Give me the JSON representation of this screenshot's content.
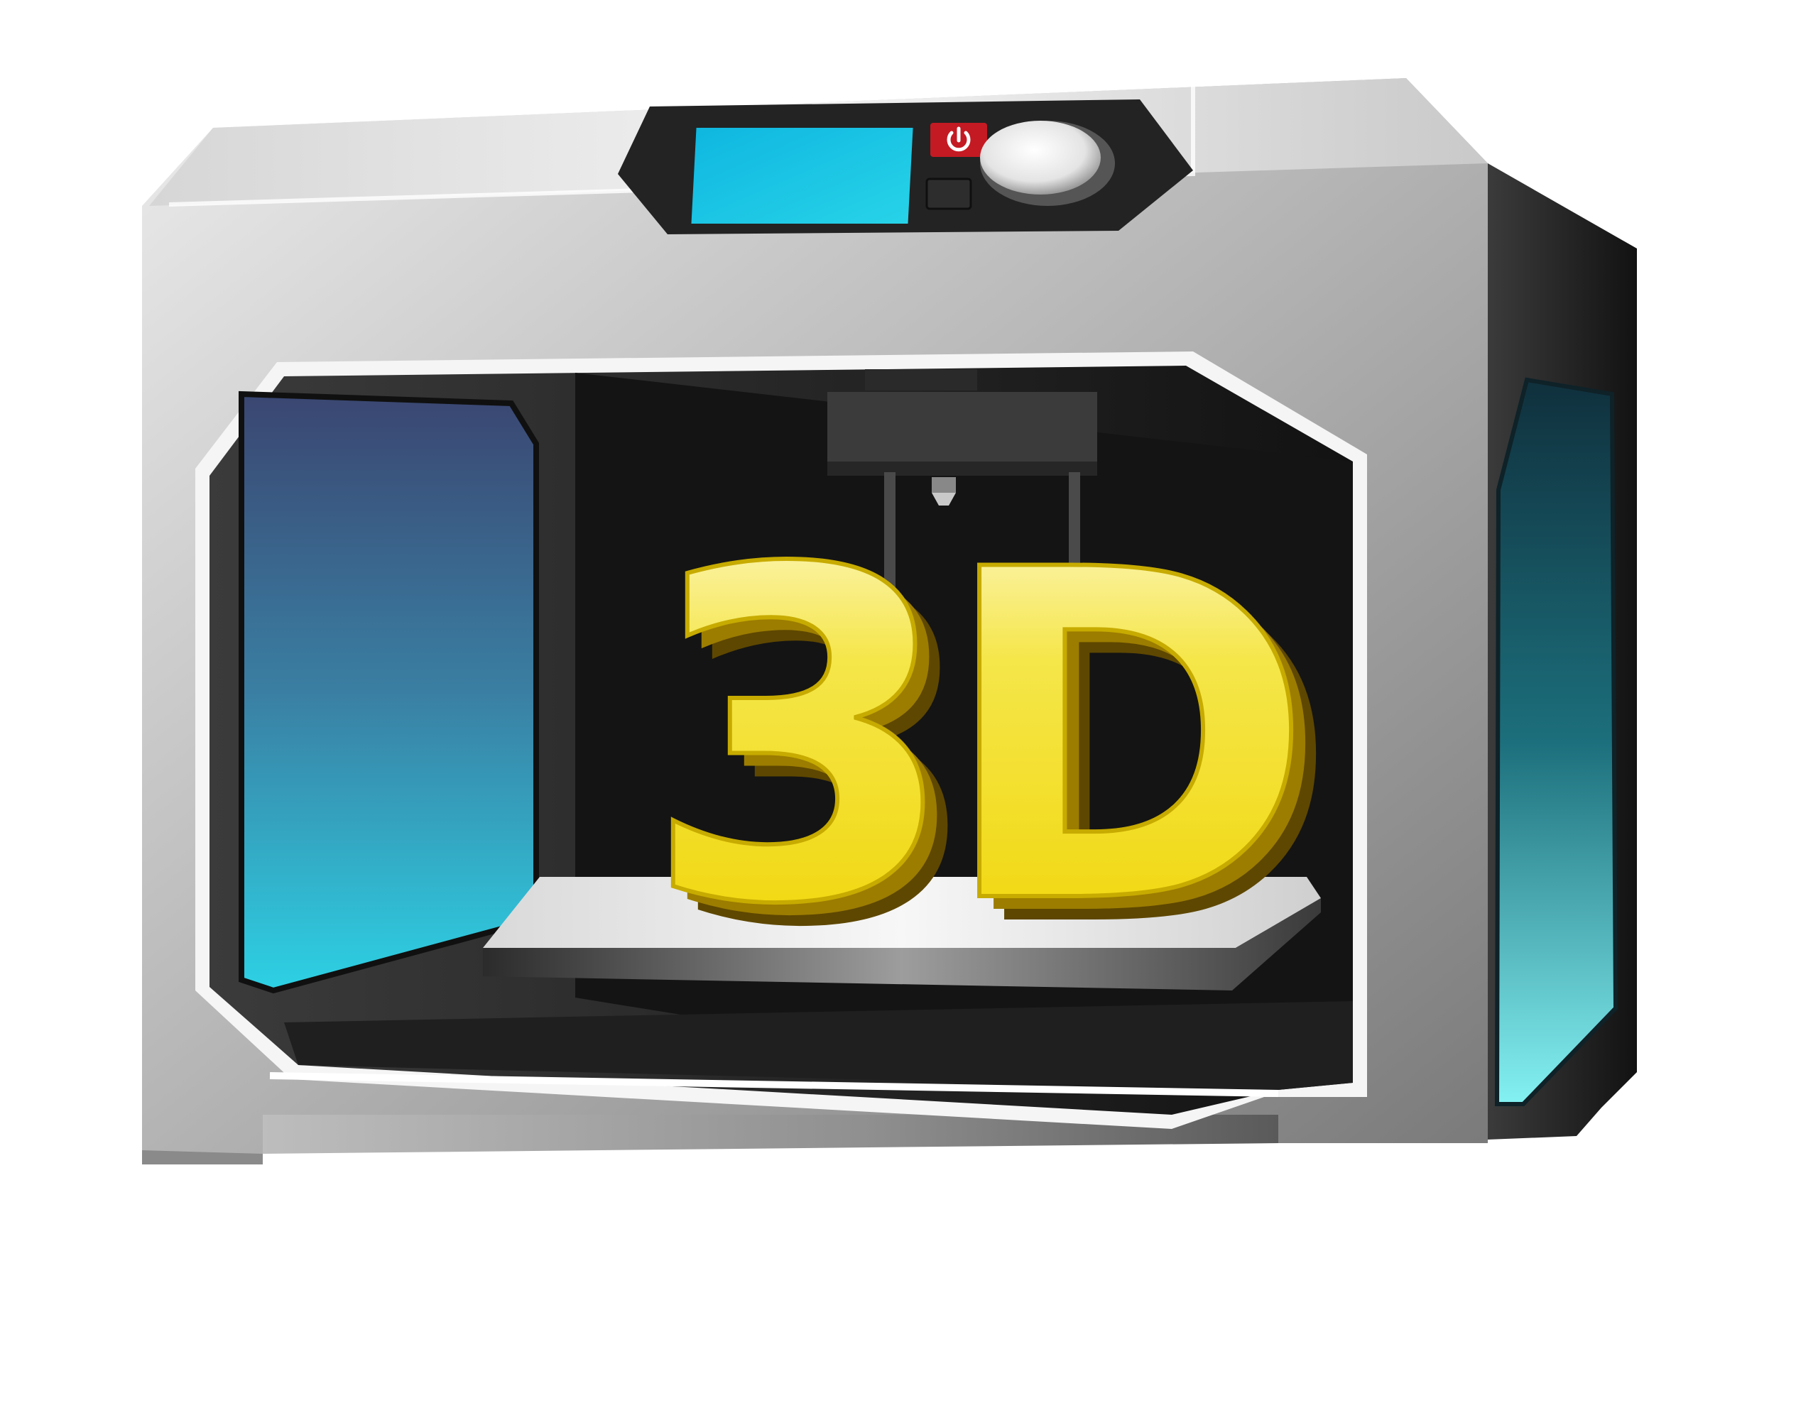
{
  "printer": {
    "model_text": "3D",
    "power_icon": "power-icon",
    "colors": {
      "body_light": "#e6e6e6",
      "body_mid": "#a9a9a9",
      "body_dark": "#5c5c5c",
      "side_dark": "#1f1f1f",
      "chamber": "#141414",
      "screen": "#20c8e6",
      "left_window_top": "#394a74",
      "left_window_bottom": "#2ccbe0",
      "right_window": "#1aa7b8",
      "power_button": "#d8202a",
      "text_face": "#f2d900",
      "text_shadow": "#6b5300"
    }
  }
}
